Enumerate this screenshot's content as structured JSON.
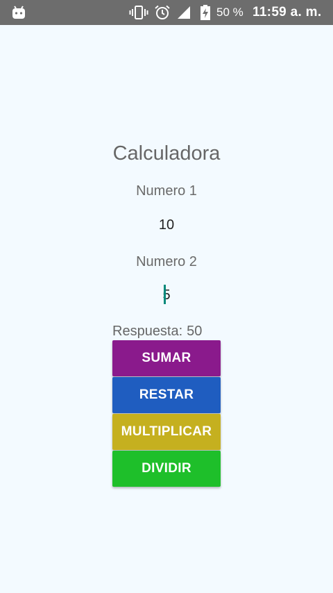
{
  "status_bar": {
    "battery_text": "50 %",
    "time": "11:59 a. m.",
    "icons": [
      "android-icon",
      "vibrate-icon",
      "alarm-icon",
      "signal-icon",
      "battery-icon"
    ]
  },
  "main": {
    "title": "Calculadora",
    "label_1": "Numero 1",
    "input_1_value": "10",
    "label_2": "Numero 2",
    "input_2_value": "5",
    "answer_label": "Respuesta:",
    "answer_value": "50"
  },
  "buttons": {
    "sumar": "SUMAR",
    "restar": "RESTAR",
    "multiplicar": "MULTIPLICAR",
    "dividir": "DIVIDIR"
  },
  "colors": {
    "background": "#f3faff",
    "status_bar": "#6d6d6d",
    "sumar": "#8a1a8c",
    "restar": "#1f5dc0",
    "multiplicar": "#c5b01f",
    "dividir": "#1ebf2a",
    "caret": "#00897b"
  }
}
